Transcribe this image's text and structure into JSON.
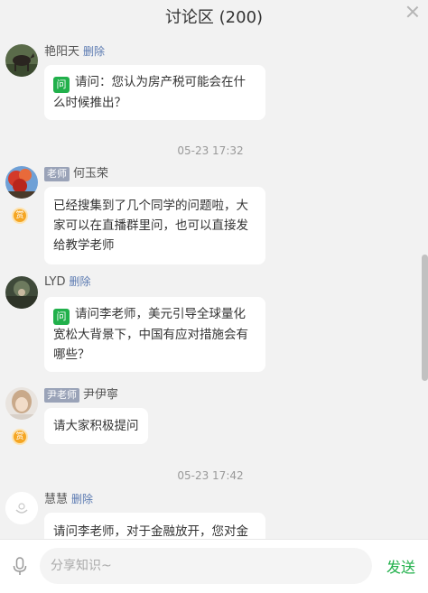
{
  "header": {
    "title": "讨论区 (200)"
  },
  "messages": [
    {
      "name": "艳阳天",
      "role": "",
      "delete_label": "删除",
      "is_question": true,
      "question_badge": "问",
      "text": "请问：您认为房产税可能会在什么时候推出？",
      "reward_badge": ""
    },
    {
      "type": "time",
      "text": "05-23 17:32"
    },
    {
      "name": "何玉荣",
      "role": "老师",
      "delete_label": "",
      "is_question": false,
      "text": "已经搜集到了几个同学的问题啦，大家可以在直播群里问，也可以直接发给教学老师",
      "reward_badge": "赏"
    },
    {
      "name": "LYD",
      "role": "",
      "delete_label": "删除",
      "is_question": true,
      "question_badge": "问",
      "text": "请问李老师，美元引导全球量化宽松大背景下，中国有应对措施会有哪些？",
      "reward_badge": ""
    },
    {
      "name": "尹伊寧",
      "role": "尹老师",
      "delete_label": "",
      "is_question": false,
      "text": "请大家积极提问",
      "reward_badge": "赏"
    },
    {
      "type": "time",
      "text": "05-23 17:42"
    },
    {
      "name": "慧慧",
      "role": "",
      "delete_label": "删除",
      "is_question": false,
      "text": "请问李老师，对于金融放开，您对金",
      "reward_badge": ""
    }
  ],
  "footer": {
    "placeholder": "分享知识~",
    "send_label": "发送"
  },
  "colors": {
    "accent": "#21b04b",
    "link": "#5b7ab1"
  }
}
